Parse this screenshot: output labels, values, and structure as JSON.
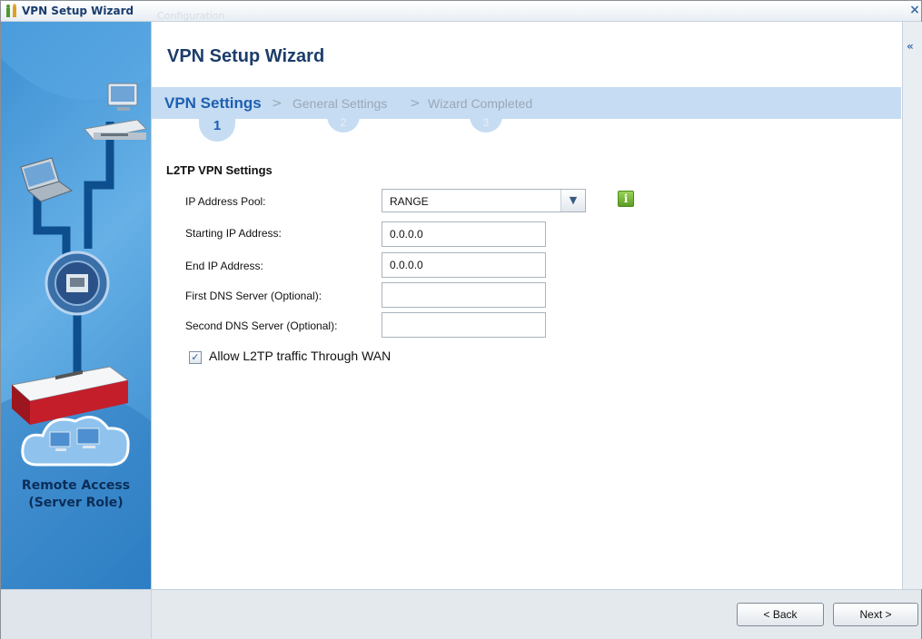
{
  "window": {
    "title": "VPN Setup Wizard",
    "ghost_tab": "Configuration",
    "icon": "wizard-icon",
    "close_glyph": "×",
    "collapse_glyph": "«"
  },
  "sidebar": {
    "role_line1": "Remote Access",
    "role_line2": "(Server Role)"
  },
  "main": {
    "title": "VPN Setup Wizard",
    "steps": [
      {
        "label": "VPN Settings",
        "number": "1",
        "active": true
      },
      {
        "label": "General Settings",
        "number": "2",
        "active": false
      },
      {
        "label": "Wizard Completed",
        "number": "3",
        "active": false
      }
    ],
    "separator": ">",
    "section_title": "L2TP VPN Settings",
    "fields": {
      "ip_pool_label": "IP Address Pool:",
      "ip_pool_value": "RANGE",
      "start_ip_label": "Starting IP Address:",
      "start_ip_value": "0.0.0.0",
      "end_ip_label": "End IP Address:",
      "end_ip_value": "0.0.0.0",
      "dns1_label": "First DNS Server (Optional):",
      "dns1_value": "",
      "dns2_label": "Second DNS Server (Optional):",
      "dns2_value": ""
    },
    "allow_wan": {
      "label": "Allow L2TP traffic Through WAN",
      "checked": true
    }
  },
  "footer": {
    "back_label": "< Back",
    "next_label": "Next >"
  },
  "colors": {
    "accent": "#1d5fb0",
    "steps_bar": "#c6dcf2",
    "title": "#1c3d6b"
  }
}
